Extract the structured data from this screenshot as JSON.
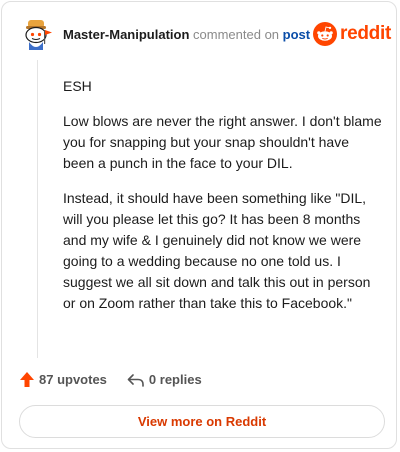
{
  "comment": {
    "username": "Master-Manipulation",
    "commented_text": "commented on",
    "post_link": "post",
    "avatar_icon": "snoo-avatar-icon",
    "paragraphs": [
      "ESH",
      "Low blows are never the right answer. I don't blame you for snapping but your snap shouldn't have been a punch in the face to your DIL.",
      "Instead, it should have been something like \"DIL, will you please let this go? It has been 8 months and my wife & I genuinely did not know we were going to a wedding because no one told us. I suggest we all sit down and talk this out in person or on Zoom rather than take this to Facebook.\""
    ]
  },
  "brand": {
    "name": "reddit",
    "icon": "reddit-logo-icon",
    "color": "#ff4500"
  },
  "actions": {
    "upvotes": "87 upvotes",
    "upvote_icon": "upvote-arrow-icon",
    "upvote_color": "#ff4500",
    "replies": "0 replies",
    "reply_icon": "reply-arrow-icon"
  },
  "footer": {
    "view_more_label": "View more on Reddit",
    "link_color": "#d93900"
  }
}
